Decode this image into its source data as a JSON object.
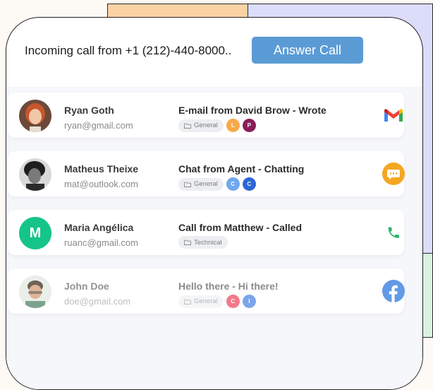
{
  "call": {
    "text": "Incoming call from +1 (212)-440-8000..",
    "answer_label": "Answer Call"
  },
  "colors": {
    "answer_button": "#5b9bd5",
    "avatar_green": "#15c489",
    "chat_orange": "#f4a622",
    "phone_green": "#2fb56a",
    "facebook_blue": "#3b82e0"
  },
  "contacts": [
    {
      "name": "Ryan Goth",
      "email": "ryan@gmail.com",
      "subject": "E-mail from David Brow - Wrote",
      "folder": "General",
      "badges": [
        {
          "letter": "L",
          "color": "#f7a84a"
        },
        {
          "letter": "P",
          "color": "#8a1e57"
        }
      ],
      "channel_icon": "gmail-icon"
    },
    {
      "name": "Matheus Theixe",
      "email": "mat@outlook.com",
      "subject": "Chat from Agent - Chatting",
      "folder": "General",
      "badges": [
        {
          "letter": "C",
          "color": "#6ea8f0"
        },
        {
          "letter": "C",
          "color": "#2c66d8"
        }
      ],
      "channel_icon": "chat-icon"
    },
    {
      "name": "Maria Angélica",
      "email": "ruanc@gmail.com",
      "subject": "Call from Matthew - Called",
      "folder": "Technical",
      "avatar_initial": "M",
      "badges": [],
      "channel_icon": "phone-icon"
    },
    {
      "name": "John Doe",
      "email": "doe@gmail.com",
      "subject": "Hello there - Hi there!",
      "folder": "General",
      "badges": [
        {
          "letter": "C",
          "color": "#ef5a6e"
        },
        {
          "letter": "I",
          "color": "#5b8fe8"
        }
      ],
      "channel_icon": "facebook-icon"
    }
  ]
}
